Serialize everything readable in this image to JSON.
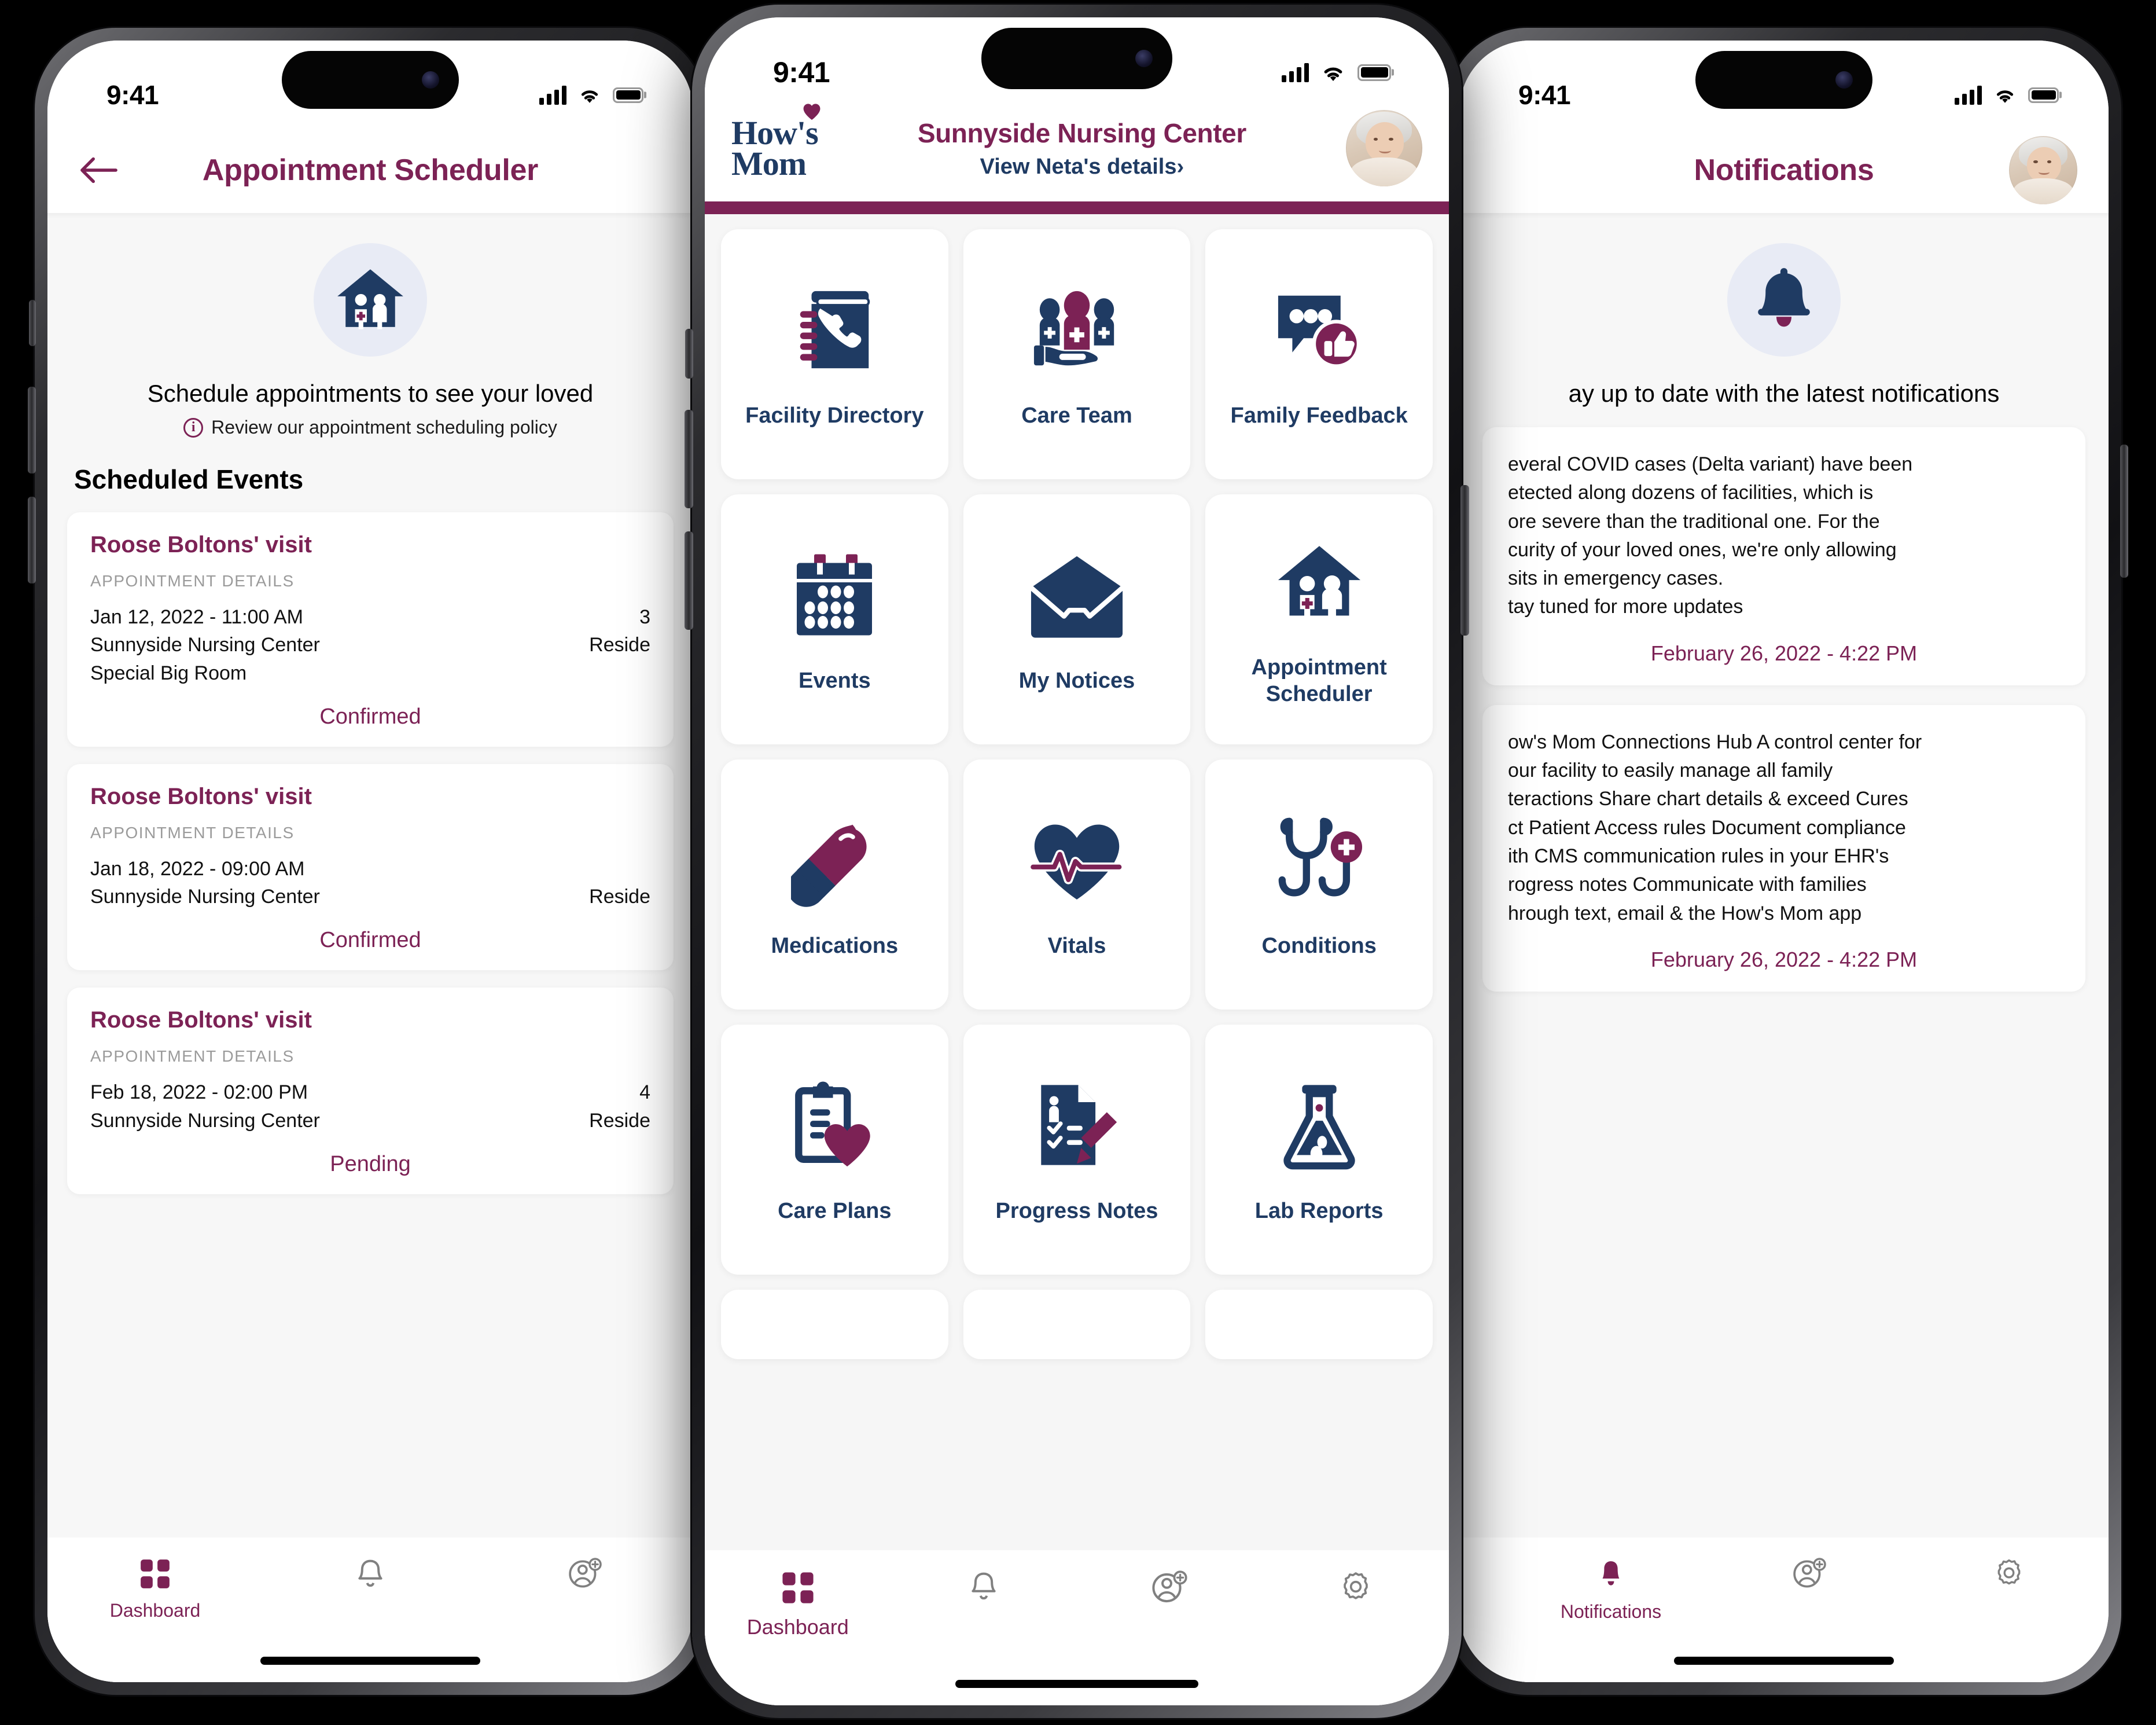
{
  "brand": {
    "navy": "#1f3b63",
    "plum": "#7c2255",
    "tile_bg": "#ffffff",
    "screen_bg": "#f7f7f7",
    "icon_circle_bg": "#e8ebf5"
  },
  "status_bar": {
    "time": "9:41"
  },
  "left_phone": {
    "appbar": {
      "title": "Appointment Scheduler",
      "back_icon": "back-arrow-icon"
    },
    "hero": {
      "icon": "nursing-home-icon",
      "headline": "Schedule appointments to see your loved",
      "policy_note": "Review our appointment scheduling policy",
      "info_icon": "info-icon"
    },
    "section_title": "Scheduled Events",
    "appointments": [
      {
        "name": "Roose Boltons' visit",
        "details_label": "APPOINTMENT DETAILS",
        "datetime": "Jan 12, 2022 - 11:00 AM",
        "facility": "Sunnyside Nursing Center",
        "room": "Special Big Room",
        "right_col_1": "3",
        "right_col_2": "Reside",
        "status": "Confirmed"
      },
      {
        "name": "Roose Boltons' visit",
        "details_label": "APPOINTMENT DETAILS",
        "datetime": "Jan 18, 2022 - 09:00 AM",
        "facility": "Sunnyside Nursing Center",
        "room": "",
        "right_col_1": "",
        "right_col_2": "Reside",
        "status": "Confirmed"
      },
      {
        "name": "Roose Boltons' visit",
        "details_label": "APPOINTMENT DETAILS",
        "datetime": "Feb 18, 2022 - 02:00 PM",
        "facility": "Sunnyside Nursing Center",
        "room": "",
        "right_col_1": "4",
        "right_col_2": "Reside",
        "status": "Pending"
      }
    ],
    "tabbar": [
      {
        "label": "Dashboard",
        "icon": "grid-dashboard-icon",
        "active": true
      },
      {
        "label": "",
        "icon": "bell-icon",
        "active": false
      },
      {
        "label": "",
        "icon": "add-contact-icon",
        "active": false
      }
    ]
  },
  "center_phone": {
    "header": {
      "logo_line1": "How's",
      "logo_line2": "Mom",
      "logo_heart_icon": "heart-icon",
      "facility_name": "Sunnyside Nursing Center",
      "resident_link": "View Neta's details›",
      "avatar_icon": "resident-avatar"
    },
    "tiles": [
      {
        "label": "Facility Directory",
        "icon": "phone-book-icon"
      },
      {
        "label": "Care Team",
        "icon": "care-team-icon"
      },
      {
        "label": "Family Feedback",
        "icon": "chat-thumbsup-icon"
      },
      {
        "label": "Events",
        "icon": "calendar-icon"
      },
      {
        "label": "My Notices",
        "icon": "open-envelope-icon"
      },
      {
        "label": "Appointment Scheduler",
        "icon": "nursing-home-icon"
      },
      {
        "label": "Medications",
        "icon": "pill-capsule-icon"
      },
      {
        "label": "Vitals",
        "icon": "heart-pulse-icon"
      },
      {
        "label": "Conditions",
        "icon": "stethoscope-icon"
      },
      {
        "label": "Care Plans",
        "icon": "clipboard-heart-icon"
      },
      {
        "label": "Progress Notes",
        "icon": "document-pencil-icon"
      },
      {
        "label": "Lab Reports",
        "icon": "flask-icon"
      }
    ],
    "tabbar": [
      {
        "label": "Dashboard",
        "icon": "grid-dashboard-icon",
        "active": true
      },
      {
        "label": "",
        "icon": "bell-icon",
        "active": false
      },
      {
        "label": "",
        "icon": "add-contact-icon",
        "active": false
      },
      {
        "label": "",
        "icon": "gear-icon",
        "active": false
      }
    ]
  },
  "right_phone": {
    "appbar": {
      "title": "Notifications",
      "avatar_icon": "resident-avatar"
    },
    "hero": {
      "icon": "bell-icon-large",
      "headline": "ay up to date with the latest notifications"
    },
    "notifications": [
      {
        "body": "everal COVID cases (Delta variant) have been\netected along dozens of facilities, which is\nore severe than the traditional one. For the\ncurity of your loved ones, we're only allowing\nsits in emergency cases.\ntay tuned for more updates",
        "time": "February 26, 2022 - 4:22 PM"
      },
      {
        "body": "ow's Mom Connections Hub A control center for\nour facility to easily manage all family\nteractions Share chart details & exceed Cures\nct Patient Access rules Document compliance\nith CMS communication rules in your EHR's\nrogress notes Communicate with families\nhrough text, email & the How's Mom app",
        "time": "February 26, 2022 - 4:22 PM"
      }
    ],
    "tabbar": [
      {
        "label": "Notifications",
        "icon": "bell-icon",
        "active": true
      },
      {
        "label": "",
        "icon": "add-contact-icon",
        "active": false
      },
      {
        "label": "",
        "icon": "gear-icon",
        "active": false
      }
    ]
  }
}
